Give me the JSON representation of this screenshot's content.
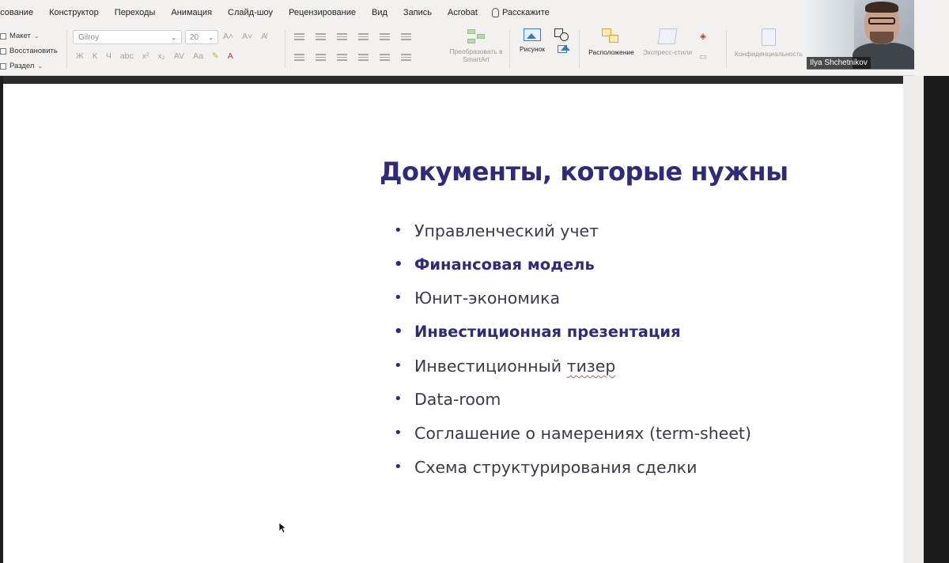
{
  "ribbon": {
    "tabs": [
      "исование",
      "Конструктор",
      "Переходы",
      "Анимация",
      "Слайд-шоу",
      "Рецензирование",
      "Вид",
      "Запись",
      "Acrobat"
    ],
    "tell_me": "Расскажите",
    "slides_group": {
      "layout": "Макет",
      "reset": "Восстановить",
      "section": "Раздел"
    },
    "font": {
      "name": "Gilroy",
      "size": "20"
    },
    "format_glyphs": [
      "Ж",
      "К",
      "Ч",
      "abc",
      "x²",
      "x₂",
      "AV",
      "Aa"
    ],
    "smartart": "Преобразовать в SmartArt",
    "picture": "Рисунок",
    "arrange": "Расположение",
    "quick_styles": "Экспресс-стили",
    "sensitivity": "Конфиденциальность"
  },
  "webcam": {
    "name": "Ilya Shchetnikov"
  },
  "slide": {
    "title": "Документы, которые нужны",
    "bullets": [
      {
        "text": "Управленческий учет",
        "bold": false
      },
      {
        "text": "Финансовая модель",
        "bold": true
      },
      {
        "text": "Юнит-экономика",
        "bold": false
      },
      {
        "text": "Инвестиционная презентация",
        "bold": true
      },
      {
        "text_before": "Инвестиционный ",
        "text_flagged": "тизер",
        "bold": false
      },
      {
        "text": "Data-room",
        "bold": false
      },
      {
        "text": "Соглашение о намерениях (term-sheet)",
        "bold": false
      },
      {
        "text": "Схема структурирования сделки",
        "bold": false
      }
    ]
  },
  "colors": {
    "title": "#2e2b7a",
    "body": "#3a3a4a",
    "spellcheck": "#d9534f"
  }
}
